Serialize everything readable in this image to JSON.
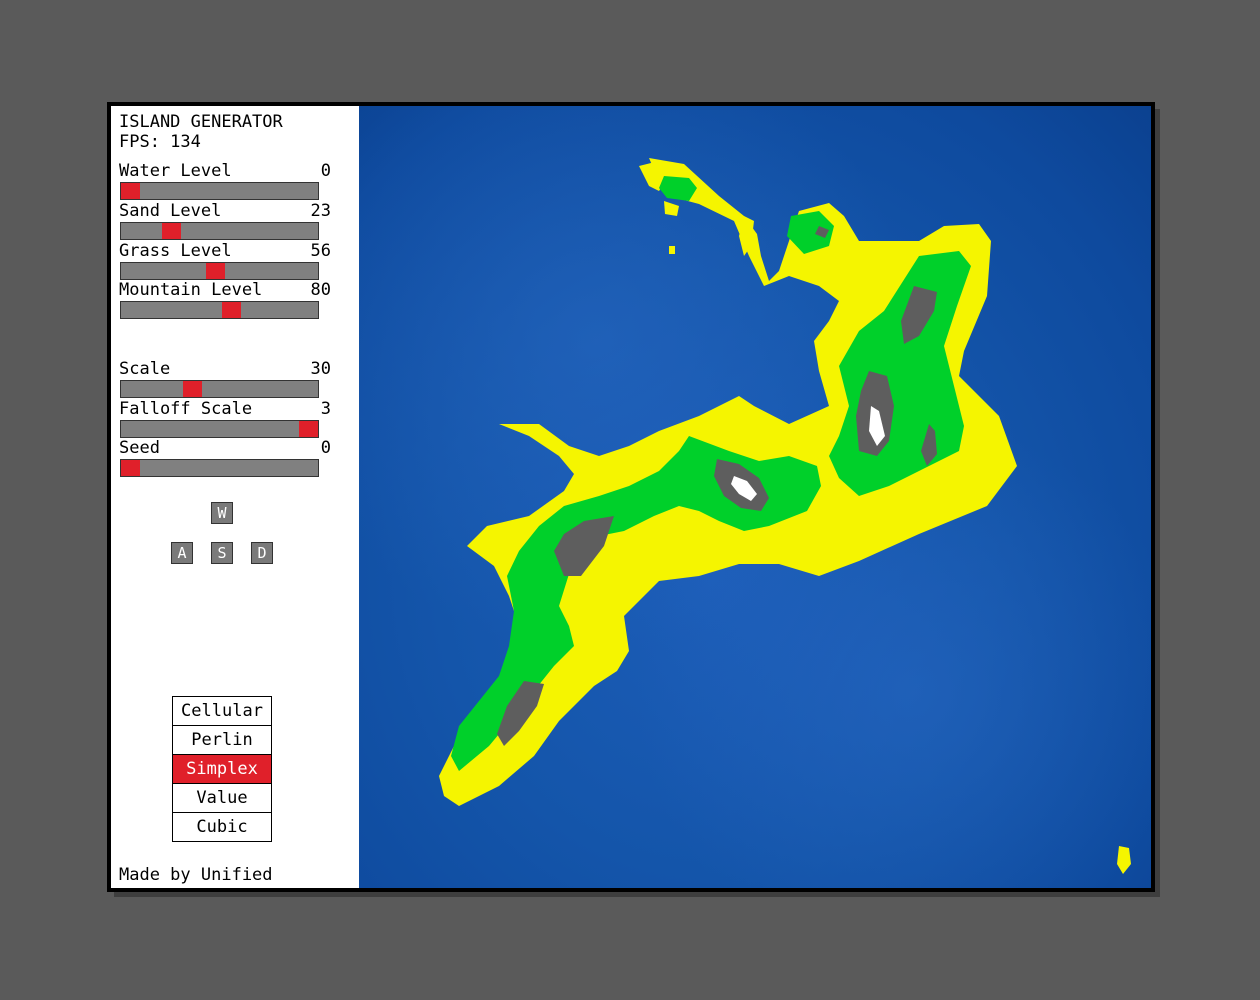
{
  "panel": {
    "title": "ISLAND GENERATOR",
    "fps": "FPS: 134",
    "sliders": [
      {
        "label": "Water Level",
        "value": "0",
        "fraction": 0.0
      },
      {
        "label": "Sand Level",
        "value": "23",
        "fraction": 0.23
      },
      {
        "label": "Grass Level",
        "value": "56",
        "fraction": 0.48
      },
      {
        "label": "Mountain Level",
        "value": "80",
        "fraction": 0.57
      }
    ],
    "sliders2": [
      {
        "label": "Scale",
        "value": "30",
        "fraction": 0.35
      },
      {
        "label": "Falloff Scale",
        "value": "3",
        "fraction": 1.0
      },
      {
        "label": "Seed",
        "value": "0",
        "fraction": 0.0
      }
    ],
    "keys": {
      "up": "W",
      "left": "A",
      "down": "S",
      "right": "D"
    },
    "noise_types": [
      "Cellular",
      "Perlin",
      "Simplex",
      "Value",
      "Cubic"
    ],
    "selected_noise": "Simplex",
    "credits": "Made by Unified"
  },
  "colors": {
    "water": "#1455aa",
    "sand": "#f5f500",
    "grass": "#00d02a",
    "mountain": "#5e5e5e",
    "snow": "#ffffff",
    "slider_thumb": "#e0202a",
    "slider_track": "#808080"
  }
}
